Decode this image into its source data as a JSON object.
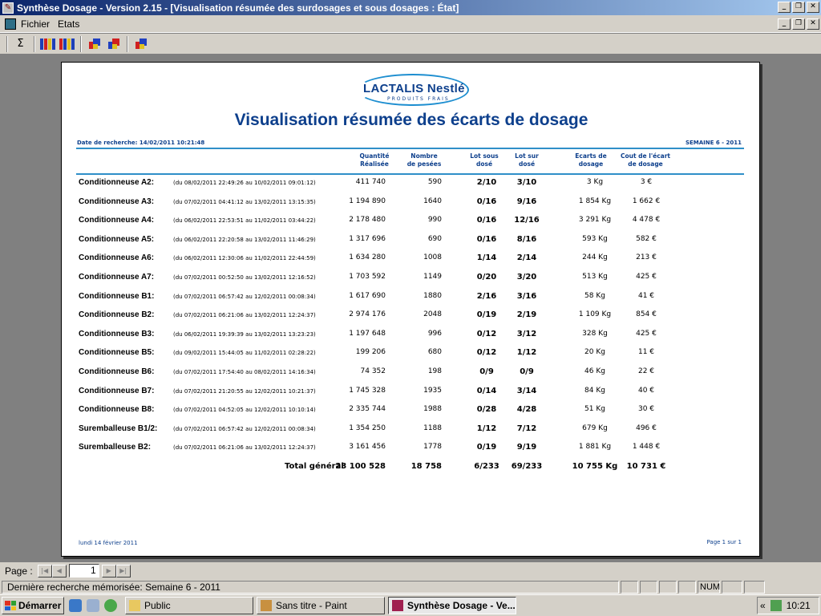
{
  "window": {
    "title": "Synthèse Dosage - Version 2.15 - [Visualisation résumée des surdosages et sous dosages : État]",
    "btn_min": "_",
    "btn_restore": "❐",
    "btn_close": "✕"
  },
  "menu": {
    "items": [
      "Fichier",
      "Etats"
    ]
  },
  "toolbar": {
    "sum_label": "Σ"
  },
  "report": {
    "logo_text": "LACTALIS Nestlé",
    "logo_sub": "PRODUITS FRAIS",
    "title": "Visualisation résumée des écarts de dosage",
    "search_date": "Date de recherche: 14/02/2011 10:21:48",
    "week": "SEMAINE 6 - 2011",
    "columns": {
      "qty": "Quantité\nRéalisée",
      "pesees": "Nombre\nde pesées",
      "lot_sous": "Lot sous\ndosé",
      "lot_sur": "Lot sur\ndosé",
      "ecarts": "Ecarts de\ndosage",
      "cout": "Cout de l'écart\nde dosage"
    },
    "rows": [
      {
        "name": "Conditionneuse A2:",
        "period": "(du 08/02/2011 22:49:26 au 10/02/2011 09:01:12)",
        "qty": "411 740",
        "pesees": "590",
        "lot_sous": "2/10",
        "lot_sur": "3/10",
        "ecarts": "3 Kg",
        "cout": "3 €"
      },
      {
        "name": "Conditionneuse A3:",
        "period": "(du 07/02/2011 04:41:12 au 13/02/2011 13:15:35)",
        "qty": "1 194 890",
        "pesees": "1640",
        "lot_sous": "0/16",
        "lot_sur": "9/16",
        "ecarts": "1 854 Kg",
        "cout": "1 662 €"
      },
      {
        "name": "Conditionneuse A4:",
        "period": "(du 06/02/2011 22:53:51 au 11/02/2011 03:44:22)",
        "qty": "2 178 480",
        "pesees": "990",
        "lot_sous": "0/16",
        "lot_sur": "12/16",
        "ecarts": "3 291 Kg",
        "cout": "4 478 €"
      },
      {
        "name": "Conditionneuse A5:",
        "period": "(du 06/02/2011 22:20:58 au 13/02/2011 11:46:29)",
        "qty": "1 317 696",
        "pesees": "690",
        "lot_sous": "0/16",
        "lot_sur": "8/16",
        "ecarts": "593 Kg",
        "cout": "582 €"
      },
      {
        "name": "Conditionneuse A6:",
        "period": "(du 06/02/2011 12:30:06 au 11/02/2011 22:44:59)",
        "qty": "1 634 280",
        "pesees": "1008",
        "lot_sous": "1/14",
        "lot_sur": "2/14",
        "ecarts": "244 Kg",
        "cout": "213 €"
      },
      {
        "name": "Conditionneuse A7:",
        "period": "(du 07/02/2011 00:52:50 au 13/02/2011 12:16:52)",
        "qty": "1 703 592",
        "pesees": "1149",
        "lot_sous": "0/20",
        "lot_sur": "3/20",
        "ecarts": "513 Kg",
        "cout": "425 €"
      },
      {
        "name": "Conditionneuse B1:",
        "period": "(du 07/02/2011 06:57:42 au 12/02/2011 00:08:34)",
        "qty": "1 617 690",
        "pesees": "1880",
        "lot_sous": "2/16",
        "lot_sur": "3/16",
        "ecarts": "58 Kg",
        "cout": "41 €"
      },
      {
        "name": "Conditionneuse B2:",
        "period": "(du 07/02/2011 06:21:06 au 13/02/2011 12:24:37)",
        "qty": "2 974 176",
        "pesees": "2048",
        "lot_sous": "0/19",
        "lot_sur": "2/19",
        "ecarts": "1 109 Kg",
        "cout": "854 €"
      },
      {
        "name": "Conditionneuse B3:",
        "period": "(du 06/02/2011 19:39:39 au 13/02/2011 13:23:23)",
        "qty": "1 197 648",
        "pesees": "996",
        "lot_sous": "0/12",
        "lot_sur": "3/12",
        "ecarts": "328 Kg",
        "cout": "425 €"
      },
      {
        "name": "Conditionneuse B5:",
        "period": "(du 09/02/2011 15:44:05 au 11/02/2011 02:28:22)",
        "qty": "199 206",
        "pesees": "680",
        "lot_sous": "0/12",
        "lot_sur": "1/12",
        "ecarts": "20 Kg",
        "cout": "11 €"
      },
      {
        "name": "Conditionneuse B6:",
        "period": "(du 07/02/2011 17:54:40 au 08/02/2011 14:16:34)",
        "qty": "74 352",
        "pesees": "198",
        "lot_sous": "0/9",
        "lot_sur": "0/9",
        "ecarts": "46 Kg",
        "cout": "22 €"
      },
      {
        "name": "Conditionneuse B7:",
        "period": "(du 07/02/2011 21:20:55 au 12/02/2011 10:21:37)",
        "qty": "1 745 328",
        "pesees": "1935",
        "lot_sous": "0/14",
        "lot_sur": "3/14",
        "ecarts": "84 Kg",
        "cout": "40 €"
      },
      {
        "name": "Conditionneuse B8:",
        "period": "(du 07/02/2011 04:52:05 au 12/02/2011 10:10:14)",
        "qty": "2 335 744",
        "pesees": "1988",
        "lot_sous": "0/28",
        "lot_sur": "4/28",
        "ecarts": "51 Kg",
        "cout": "30 €"
      },
      {
        "name": "Suremballeuse B1/2:",
        "period": "(du 07/02/2011 06:57:42 au 12/02/2011 00:08:34)",
        "qty": "1 354 250",
        "pesees": "1188",
        "lot_sous": "1/12",
        "lot_sur": "7/12",
        "ecarts": "679 Kg",
        "cout": "496 €"
      },
      {
        "name": "Suremballeuse B2:",
        "period": "(du 07/02/2011 06:21:06 au 13/02/2011 12:24:37)",
        "qty": "3 161 456",
        "pesees": "1778",
        "lot_sous": "0/19",
        "lot_sur": "9/19",
        "ecarts": "1 881 Kg",
        "cout": "1 448 €"
      }
    ],
    "total": {
      "label": "Total général",
      "qty": "23 100 528",
      "pesees": "18 758",
      "lot_sous": "6/233",
      "lot_sur": "69/233",
      "ecarts": "10 755 Kg",
      "cout": "10 731 €"
    },
    "footer_date": "lundi 14 février 2011",
    "footer_page": "Page 1 sur 1"
  },
  "pagenav": {
    "label": "Page :",
    "first": "|◀",
    "prev": "◀",
    "value": "1",
    "next": "▶",
    "last": "▶|"
  },
  "status": {
    "text": "Dernière recherche mémorisée: Semaine 6 - 2011",
    "num": "NUM"
  },
  "taskbar": {
    "start": "Démarrer",
    "tasks": [
      "Public",
      "Sans titre - Paint",
      "Synthèse Dosage - Ve..."
    ],
    "clock": "10:21",
    "tray_chevron": "«"
  }
}
